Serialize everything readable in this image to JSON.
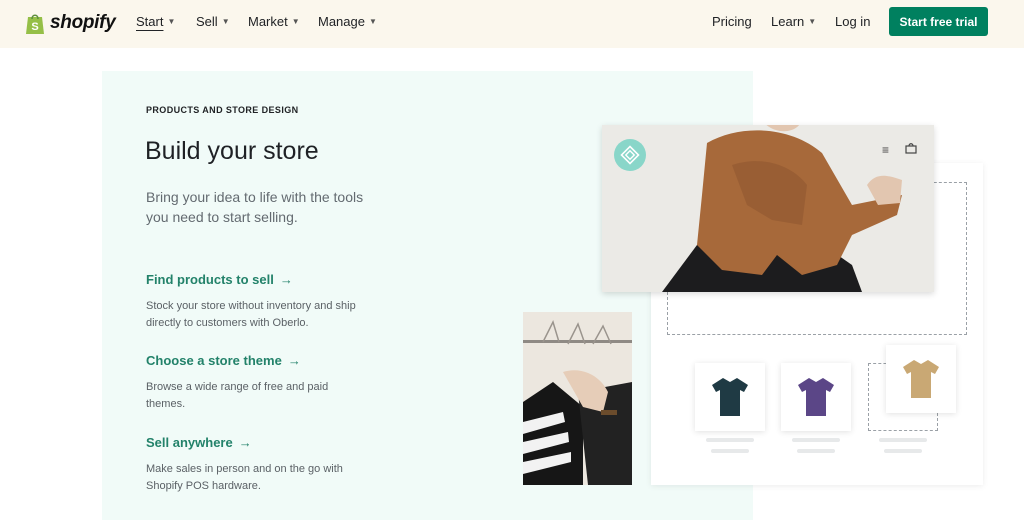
{
  "header": {
    "logo_text": "shopify",
    "nav": [
      {
        "label": "Start",
        "active": true
      },
      {
        "label": "Sell"
      },
      {
        "label": "Market"
      },
      {
        "label": "Manage"
      }
    ],
    "right": {
      "pricing": "Pricing",
      "learn": "Learn",
      "login": "Log in",
      "cta": "Start free trial"
    }
  },
  "main": {
    "eyebrow": "PRODUCTS AND STORE DESIGN",
    "headline": "Build your store",
    "lede": "Bring your idea to life with the tools you need to start selling.",
    "features": [
      {
        "title": "Find products to sell",
        "desc": "Stock your store without inventory and ship directly to customers with Oberlo."
      },
      {
        "title": "Choose a store theme",
        "desc": "Browse a wide range of free and paid themes."
      },
      {
        "title": "Sell anywhere",
        "desc": "Make sales in person and on the go with Shopify POS hardware."
      }
    ]
  },
  "icons": {
    "arrow": "→",
    "caret": "⌄",
    "menu": "≡",
    "bag": "bag"
  },
  "colors": {
    "header_bg": "#fbf7ed",
    "panel_bg": "#f1fbf8",
    "accent": "#00805f",
    "link": "#23826a",
    "shirt_navy": "#1f3a44",
    "shirt_purple": "#5b4687",
    "shirt_tan": "#c9a874",
    "scarf": "#a7693a"
  }
}
